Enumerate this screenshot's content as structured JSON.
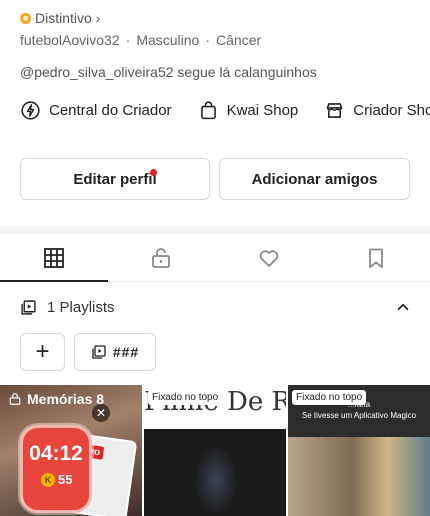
{
  "profile": {
    "badge_label": "Distintivo",
    "username": "futebolAovivo32",
    "gender": "Masculino",
    "sign": "Câncer",
    "follow_text": "@pedro_silva_oliveira52 segue lá calanguinhos"
  },
  "shortcuts": [
    {
      "label": "Central do Criador",
      "icon": "lightning-icon"
    },
    {
      "label": "Kwai Shop",
      "icon": "shopping-bag-icon"
    },
    {
      "label": "Criador Shop",
      "icon": "store-icon"
    }
  ],
  "actions": {
    "edit_profile": "Editar perfil",
    "add_friends": "Adicionar amigos"
  },
  "tabs": [
    {
      "name": "grid",
      "icon": "grid-icon",
      "active": true
    },
    {
      "name": "private",
      "icon": "lock-icon",
      "active": false
    },
    {
      "name": "liked",
      "icon": "heart-icon",
      "active": false
    },
    {
      "name": "saved",
      "icon": "bookmark-icon",
      "active": false
    }
  ],
  "playlists": {
    "label": "1 Playlists",
    "chip_label": "###"
  },
  "videos": [
    {
      "label": "Memórias 8",
      "timer": "04:12",
      "coins": "55",
      "tag": "vo"
    },
    {
      "pin_label": "Fixado no topo",
      "title_text": "Filme De R"
    },
    {
      "pin_label": "Fixado no topo",
      "subtitle": "...faria\nSe tivesse um Aplicativo Magico"
    }
  ],
  "colors": {
    "accent_red": "#e02424",
    "badge_gold": "#f5a623",
    "timer_red": "#e8453c"
  }
}
